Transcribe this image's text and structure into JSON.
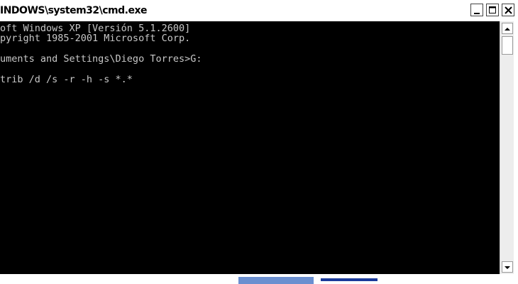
{
  "window": {
    "title": "INDOWS\\system32\\cmd.exe",
    "buttons": {
      "minimize_icon": "minimize-icon",
      "maximize_icon": "maximize-icon",
      "close_icon": "close-icon"
    }
  },
  "console": {
    "lines": [
      "oft Windows XP [Versión 5.1.2600]",
      "pyright 1985-2001 Microsoft Corp.",
      "uments and Settings\\Diego Torres>G:",
      "trib /d /s -r -h -s *.*"
    ],
    "background": "#000000",
    "text_color": "#c8c8c8"
  }
}
